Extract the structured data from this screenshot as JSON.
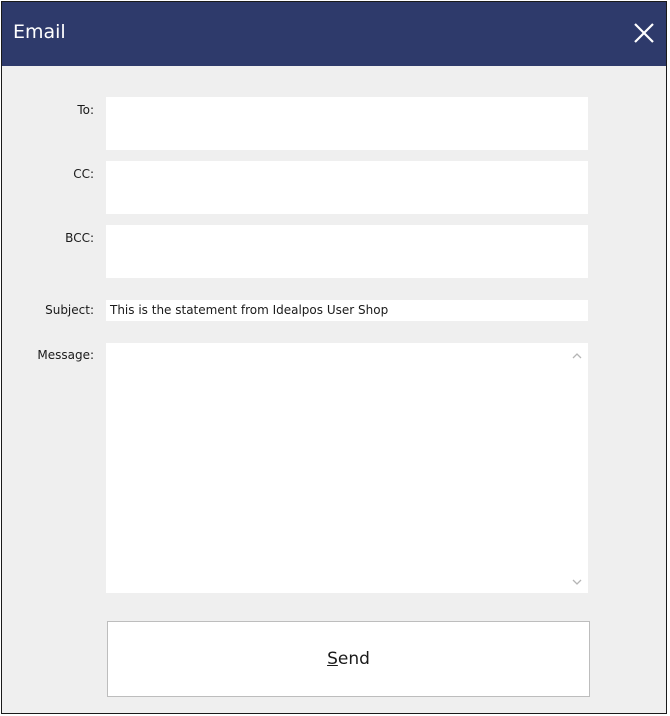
{
  "window": {
    "title": "Email",
    "close_icon": "close-icon",
    "title_bar_color": "#2e3a6b"
  },
  "form": {
    "to_label": "To:",
    "to_value": "",
    "cc_label": "CC:",
    "cc_value": "",
    "bcc_label": "BCC:",
    "bcc_value": "",
    "subject_label": "Subject:",
    "subject_value": "This is the statement from Idealpos User Shop",
    "message_label": "Message:",
    "message_value": ""
  },
  "send_button": {
    "mnemonic": "S",
    "rest": "end"
  }
}
